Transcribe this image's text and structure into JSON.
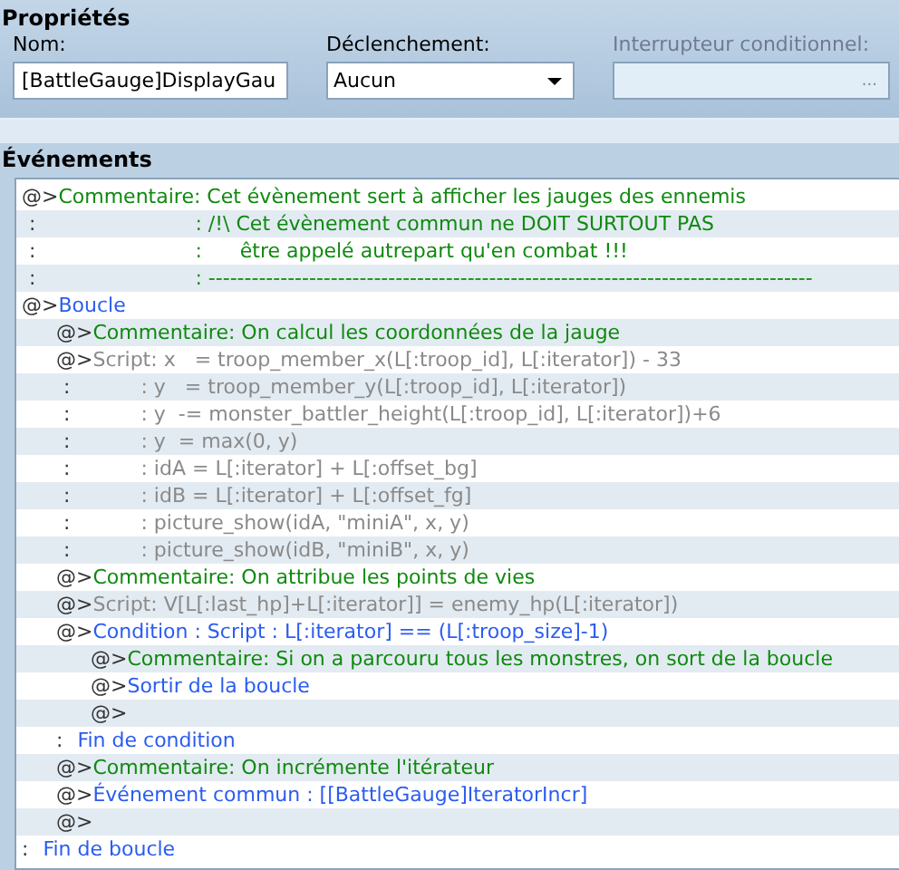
{
  "properties": {
    "title": "Propriétés",
    "name_field": {
      "label": "Nom:",
      "value": "[BattleGauge]DisplayGau"
    },
    "trigger": {
      "label": "Déclenchement:",
      "value": "Aucun"
    },
    "switch": {
      "label": "Interrupteur conditionnel:",
      "button": "...",
      "disabled": true
    }
  },
  "events": {
    "title": "Événements",
    "commands": [
      {
        "kind": "comment",
        "marker": "@>",
        "text": "Commentaire: Cet évènement sert à afficher les jauges des ennemis",
        "continuations": [
          {
            "marker": ":",
            "text": ": /!\\ Cet évènement commun ne DOIT SURTOUT PAS"
          },
          {
            "marker": ":",
            "text": ":      être appelé autrepart qu'en combat !!!"
          },
          {
            "marker": ":",
            "text": ": ------------------------------------------------------------------------------------"
          }
        ]
      },
      {
        "kind": "flow",
        "marker": "@>",
        "text": "Boucle",
        "children": [
          {
            "kind": "comment",
            "marker": "@>",
            "text": "Commentaire: On calcul les coordonnées de la jauge"
          },
          {
            "kind": "script",
            "marker": "@>",
            "text": "Script: x   = troop_member_x(L[:troop_id], L[:iterator]) - 33",
            "continuations": [
              {
                "marker": ":",
                "text": ": y   = troop_member_y(L[:troop_id], L[:iterator])"
              },
              {
                "marker": ":",
                "text": ": y  -= monster_battler_height(L[:troop_id], L[:iterator])+6"
              },
              {
                "marker": ":",
                "text": ": y  = max(0, y)"
              },
              {
                "marker": ":",
                "text": ": idA = L[:iterator] + L[:offset_bg]"
              },
              {
                "marker": ":",
                "text": ": idB = L[:iterator] + L[:offset_fg]"
              },
              {
                "marker": ":",
                "text": ": picture_show(idA, \"miniA\", x, y)"
              },
              {
                "marker": ":",
                "text": ": picture_show(idB, \"miniB\", x, y)"
              }
            ]
          },
          {
            "kind": "comment",
            "marker": "@>",
            "text": "Commentaire: On attribue les points de vies"
          },
          {
            "kind": "script",
            "marker": "@>",
            "text": "Script: V[L[:last_hp]+L[:iterator]] = enemy_hp(L[:iterator])"
          },
          {
            "kind": "flow",
            "marker": "@>",
            "text": "Condition : Script : L[:iterator] == (L[:troop_size]-1)",
            "children": [
              {
                "kind": "comment",
                "marker": "@>",
                "text": "Commentaire: Si on a parcouru tous les monstres, on sort de la boucle"
              },
              {
                "kind": "flow",
                "marker": "@>",
                "text": "Sortir de la boucle"
              },
              {
                "kind": "empty",
                "marker": "@>"
              }
            ]
          },
          {
            "kind": "end",
            "marker": ":",
            "text": "Fin de condition"
          },
          {
            "kind": "comment",
            "marker": "@>",
            "text": "Commentaire: On incrémente l'itérateur"
          },
          {
            "kind": "flow",
            "marker": "@>",
            "text": "Événement commun : [[BattleGauge]IteratorIncr]"
          },
          {
            "kind": "empty",
            "marker": "@>"
          }
        ]
      },
      {
        "kind": "end",
        "marker": ":",
        "text": "Fin de boucle"
      }
    ]
  }
}
